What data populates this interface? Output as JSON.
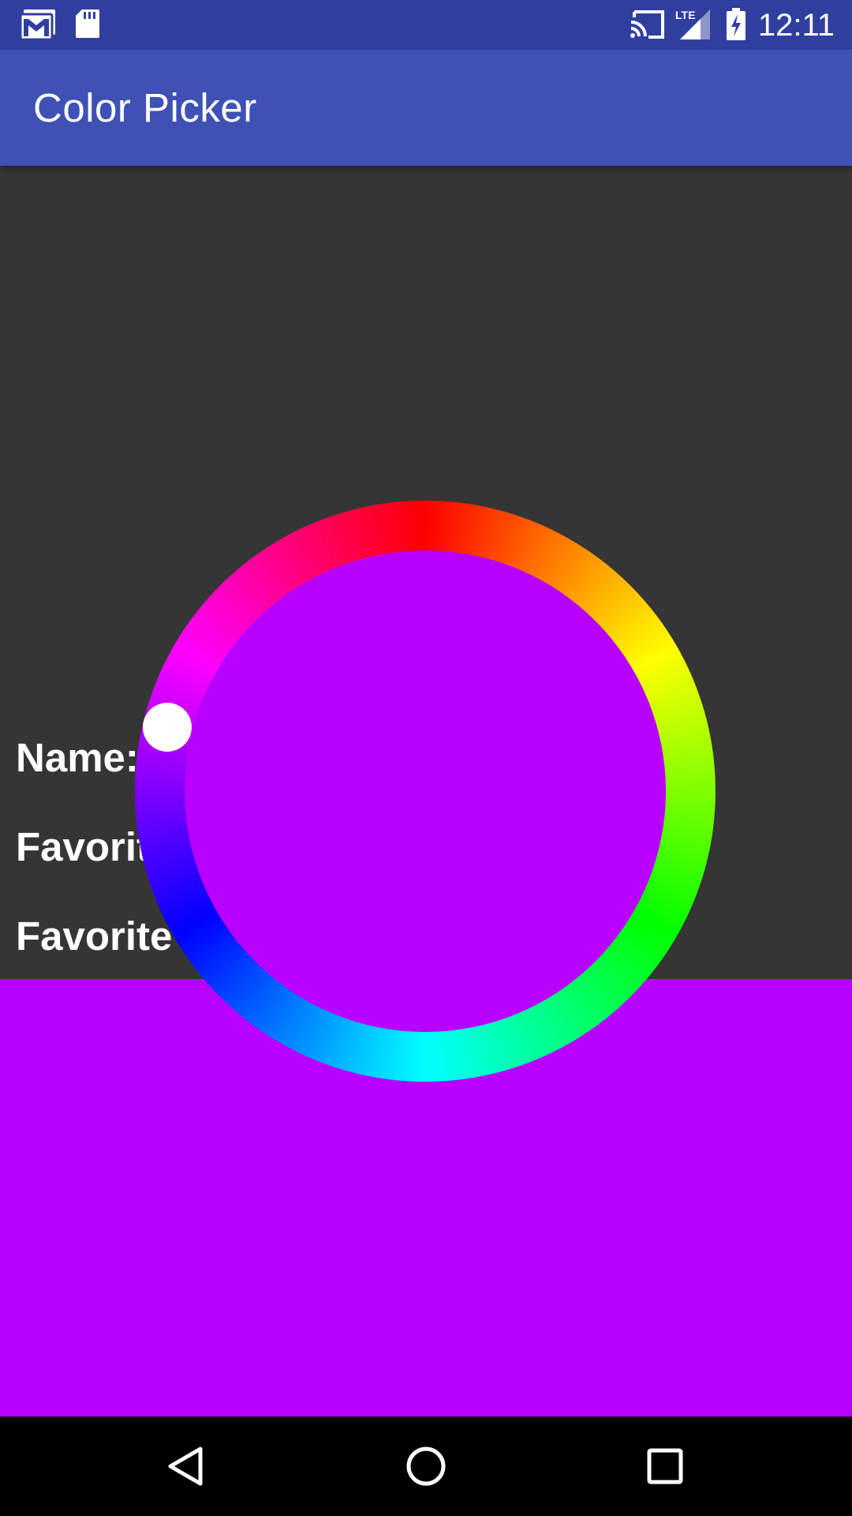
{
  "status_bar": {
    "time": "12:11",
    "icons": [
      "gmail-icon",
      "sd-card-icon",
      "cast-icon",
      "lte-signal-icon",
      "battery-charging-icon"
    ],
    "network_label": "LTE",
    "background_color": "#303F9F"
  },
  "app_bar": {
    "title": "Color Picker",
    "background_color": "#3F51B5"
  },
  "form": {
    "name_label": "Name:",
    "favorite_label_1": "Favorit",
    "favorite_label_2": "Favorite"
  },
  "color_picker": {
    "selected_color": "#B700FF",
    "ring_colors": [
      "#ff0000",
      "#ffff00",
      "#00ff00",
      "#00ffff",
      "#0000ff",
      "#ff00ff"
    ],
    "handle_color": "#FFFFFF"
  },
  "nav_bar": {
    "icons": [
      "back-icon",
      "home-icon",
      "recents-icon"
    ]
  }
}
